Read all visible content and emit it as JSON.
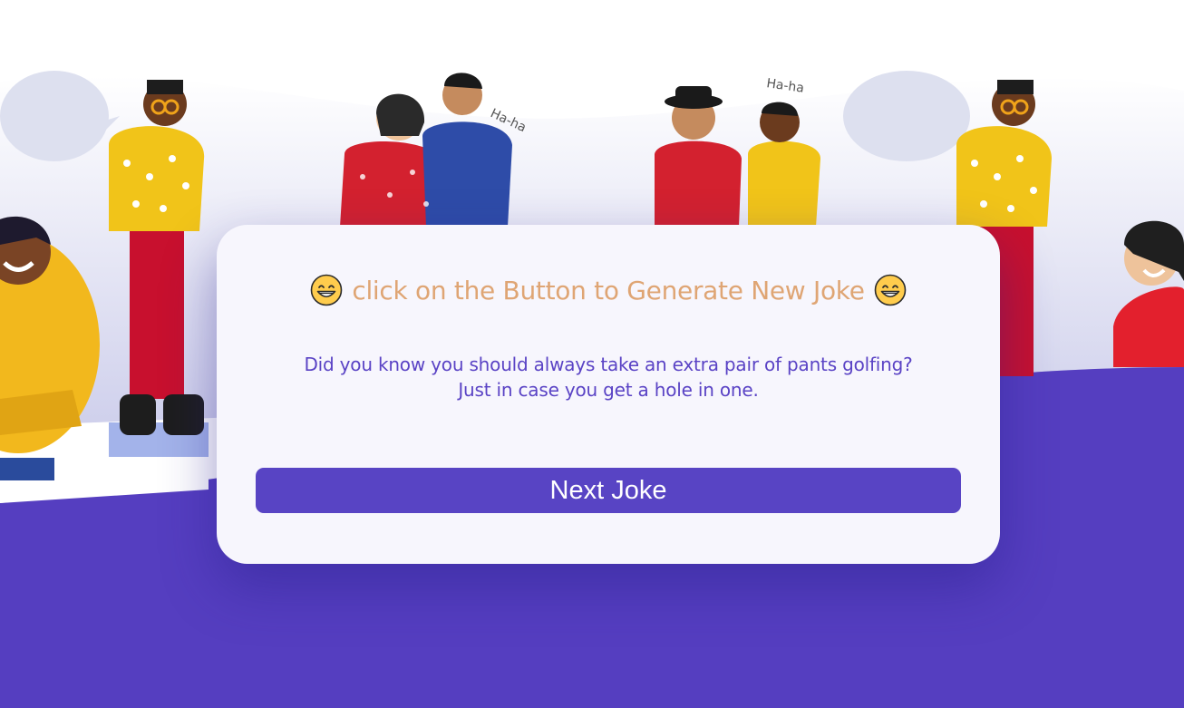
{
  "heading": {
    "left_emoji": "grinning-face-icon",
    "text": "click on the Button to Generate New Joke",
    "right_emoji": "grinning-face-icon"
  },
  "joke": {
    "line1": "Did you know you should always take an extra pair of pants golfing?",
    "line2": "Just in case you get a hole in one."
  },
  "button": {
    "label": "Next Joke"
  },
  "colors": {
    "accent": "#5844c4",
    "heading": "#dfa574",
    "joke_text": "#5a43c5",
    "card": "#f7f6fd"
  }
}
